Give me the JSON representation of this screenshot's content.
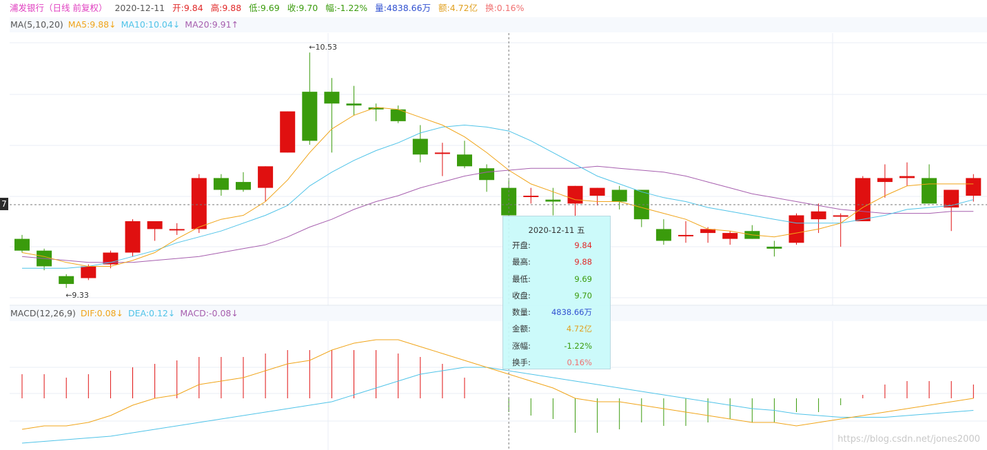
{
  "header": {
    "name": "浦发银行（日线 前复权）",
    "date": "2020-12-11",
    "open": "开:9.84",
    "high": "高:9.88",
    "low": "低:9.69",
    "close": "收:9.70",
    "change": "幅:-1.22%",
    "volume": "量:4838.66万",
    "amount": "额:4.72亿",
    "turnover": "换:0.16%"
  },
  "ma_legend": {
    "label": "MA(5,10,20)",
    "ma5": "MA5:9.88↓",
    "ma10": "MA10:10.04↓",
    "ma20": "MA20:9.91↑"
  },
  "macd_legend": {
    "label": "MACD(12,26,9)",
    "dif": "DIF:0.08↓",
    "dea": "DEA:0.12↓",
    "macd": "MACD:-0.08↓"
  },
  "tooltip": {
    "date": "2020-12-11  五",
    "rows": [
      {
        "label": "开盘:",
        "value": "9.84"
      },
      {
        "label": "最高:",
        "value": "9.88"
      },
      {
        "label": "最低:",
        "value": "9.69"
      },
      {
        "label": "收盘:",
        "value": "9.70"
      },
      {
        "label": "数量:",
        "value": "4838.66万"
      },
      {
        "label": "金额:",
        "value": "4.72亿"
      },
      {
        "label": "涨幅:",
        "value": "-1.22%"
      },
      {
        "label": "换手:",
        "value": "0.16%"
      }
    ]
  },
  "price_marker": "7",
  "watermark": "https://blog.csdn.net/jones2000",
  "colors": {
    "up": "#e01010",
    "down": "#3a9b0c",
    "ma5": "#f0a418",
    "ma10": "#4fc3e8",
    "ma20": "#a65eae",
    "name": "#e040c0",
    "date": "#555555",
    "red": "#e02828",
    "green": "#3a9b0c",
    "blue": "#3050d0",
    "amount": "#e0a020",
    "turnover": "#f07070"
  },
  "chart_data": {
    "type": "candlestick",
    "annotations": {
      "high": "←10.53",
      "low": "←9.33"
    },
    "ylim": [
      9.28,
      10.58
    ],
    "candles": [
      {
        "o": 9.58,
        "h": 9.6,
        "l": 9.51,
        "c": 9.52
      },
      {
        "o": 9.52,
        "h": 9.53,
        "l": 9.42,
        "c": 9.44
      },
      {
        "o": 9.39,
        "h": 9.4,
        "l": 9.33,
        "c": 9.35
      },
      {
        "o": 9.38,
        "h": 9.45,
        "l": 9.37,
        "c": 9.44
      },
      {
        "o": 9.45,
        "h": 9.52,
        "l": 9.43,
        "c": 9.51
      },
      {
        "o": 9.51,
        "h": 9.68,
        "l": 9.49,
        "c": 9.67
      },
      {
        "o": 9.63,
        "h": 9.67,
        "l": 9.57,
        "c": 9.67
      },
      {
        "o": 9.63,
        "h": 9.66,
        "l": 9.6,
        "c": 9.63
      },
      {
        "o": 9.63,
        "h": 9.91,
        "l": 9.61,
        "c": 9.89
      },
      {
        "o": 9.89,
        "h": 9.91,
        "l": 9.8,
        "c": 9.83
      },
      {
        "o": 9.87,
        "h": 9.92,
        "l": 9.82,
        "c": 9.83
      },
      {
        "o": 9.84,
        "h": 9.95,
        "l": 9.77,
        "c": 9.95
      },
      {
        "o": 10.02,
        "h": 10.23,
        "l": 10.02,
        "c": 10.23
      },
      {
        "o": 10.33,
        "h": 10.53,
        "l": 10.06,
        "c": 10.08
      },
      {
        "o": 10.33,
        "h": 10.4,
        "l": 10.02,
        "c": 10.27
      },
      {
        "o": 10.27,
        "h": 10.36,
        "l": 10.21,
        "c": 10.26
      },
      {
        "o": 10.25,
        "h": 10.27,
        "l": 10.18,
        "c": 10.24
      },
      {
        "o": 10.24,
        "h": 10.26,
        "l": 10.17,
        "c": 10.18
      },
      {
        "o": 10.09,
        "h": 10.16,
        "l": 9.97,
        "c": 10.01
      },
      {
        "o": 10.02,
        "h": 10.07,
        "l": 9.9,
        "c": 10.02
      },
      {
        "o": 10.01,
        "h": 10.08,
        "l": 9.94,
        "c": 9.95
      },
      {
        "o": 9.94,
        "h": 9.96,
        "l": 9.82,
        "c": 9.88
      },
      {
        "o": 9.84,
        "h": 9.88,
        "l": 9.69,
        "c": 9.7
      },
      {
        "o": 9.8,
        "h": 9.84,
        "l": 9.76,
        "c": 9.8
      },
      {
        "o": 9.78,
        "h": 9.84,
        "l": 9.7,
        "c": 9.77
      },
      {
        "o": 9.76,
        "h": 9.85,
        "l": 9.69,
        "c": 9.85
      },
      {
        "o": 9.8,
        "h": 9.84,
        "l": 9.75,
        "c": 9.84
      },
      {
        "o": 9.83,
        "h": 9.85,
        "l": 9.73,
        "c": 9.77
      },
      {
        "o": 9.83,
        "h": 9.83,
        "l": 9.64,
        "c": 9.68
      },
      {
        "o": 9.63,
        "h": 9.68,
        "l": 9.55,
        "c": 9.57
      },
      {
        "o": 9.6,
        "h": 9.67,
        "l": 9.56,
        "c": 9.6
      },
      {
        "o": 9.61,
        "h": 9.64,
        "l": 9.56,
        "c": 9.63
      },
      {
        "o": 9.58,
        "h": 9.62,
        "l": 9.55,
        "c": 9.61
      },
      {
        "o": 9.62,
        "h": 9.65,
        "l": 9.58,
        "c": 9.58
      },
      {
        "o": 9.54,
        "h": 9.57,
        "l": 9.49,
        "c": 9.53
      },
      {
        "o": 9.56,
        "h": 9.71,
        "l": 9.55,
        "c": 9.7
      },
      {
        "o": 9.68,
        "h": 9.76,
        "l": 9.61,
        "c": 9.72
      },
      {
        "o": 9.7,
        "h": 9.71,
        "l": 9.54,
        "c": 9.7
      },
      {
        "o": 9.67,
        "h": 9.9,
        "l": 9.67,
        "c": 9.89
      },
      {
        "o": 9.87,
        "h": 9.96,
        "l": 9.79,
        "c": 9.89
      },
      {
        "o": 9.89,
        "h": 9.97,
        "l": 9.85,
        "c": 9.9
      },
      {
        "o": 9.89,
        "h": 9.96,
        "l": 9.77,
        "c": 9.76
      },
      {
        "o": 9.74,
        "h": 9.83,
        "l": 9.62,
        "c": 9.83
      },
      {
        "o": 9.8,
        "h": 9.91,
        "l": 9.77,
        "c": 9.89
      }
    ],
    "ma5": [
      9.51,
      9.49,
      9.46,
      9.44,
      9.44,
      9.47,
      9.51,
      9.58,
      9.64,
      9.68,
      9.7,
      9.77,
      9.88,
      10.02,
      10.14,
      10.21,
      10.25,
      10.24,
      10.2,
      10.16,
      10.1,
      10.02,
      9.93,
      9.86,
      9.82,
      9.78,
      9.77,
      9.77,
      9.74,
      9.71,
      9.68,
      9.63,
      9.62,
      9.6,
      9.59,
      9.61,
      9.63,
      9.66,
      9.74,
      9.8,
      9.85,
      9.86,
      9.86,
      9.86
    ],
    "ma10": [
      9.43,
      9.43,
      9.43,
      9.44,
      9.46,
      9.49,
      9.52,
      9.56,
      9.59,
      9.62,
      9.66,
      9.7,
      9.75,
      9.85,
      9.92,
      9.98,
      10.03,
      10.07,
      10.12,
      10.15,
      10.16,
      10.15,
      10.13,
      10.08,
      10.02,
      9.96,
      9.9,
      9.86,
      9.82,
      9.79,
      9.77,
      9.74,
      9.72,
      9.7,
      9.68,
      9.66,
      9.66,
      9.66,
      9.68,
      9.7,
      9.73,
      9.74,
      9.75,
      9.78
    ],
    "ma20": [
      9.49,
      9.48,
      9.47,
      9.46,
      9.46,
      9.46,
      9.47,
      9.48,
      9.49,
      9.51,
      9.53,
      9.55,
      9.59,
      9.64,
      9.68,
      9.73,
      9.77,
      9.8,
      9.84,
      9.87,
      9.9,
      9.92,
      9.93,
      9.94,
      9.94,
      9.94,
      9.95,
      9.94,
      9.93,
      9.92,
      9.9,
      9.87,
      9.84,
      9.81,
      9.79,
      9.77,
      9.75,
      9.73,
      9.72,
      9.71,
      9.71,
      9.71,
      9.72,
      9.72
    ],
    "macd_ylim": [
      -0.15,
      0.22
    ],
    "dif": [
      -0.09,
      -0.08,
      -0.08,
      -0.07,
      -0.05,
      -0.02,
      0.0,
      0.01,
      0.04,
      0.05,
      0.06,
      0.08,
      0.1,
      0.11,
      0.14,
      0.16,
      0.17,
      0.17,
      0.15,
      0.13,
      0.11,
      0.09,
      0.07,
      0.05,
      0.03,
      0.0,
      -0.01,
      -0.01,
      -0.02,
      -0.03,
      -0.04,
      -0.05,
      -0.06,
      -0.07,
      -0.07,
      -0.08,
      -0.07,
      -0.06,
      -0.05,
      -0.04,
      -0.03,
      -0.02,
      -0.01,
      0.0
    ],
    "dea": [
      -0.13,
      -0.125,
      -0.12,
      -0.115,
      -0.11,
      -0.1,
      -0.09,
      -0.08,
      -0.07,
      -0.06,
      -0.05,
      -0.04,
      -0.03,
      -0.02,
      -0.01,
      0.01,
      0.03,
      0.05,
      0.07,
      0.08,
      0.09,
      0.09,
      0.08,
      0.07,
      0.06,
      0.05,
      0.04,
      0.03,
      0.02,
      0.01,
      0.0,
      -0.01,
      -0.02,
      -0.03,
      -0.035,
      -0.045,
      -0.05,
      -0.055,
      -0.055,
      -0.055,
      -0.05,
      -0.045,
      -0.04,
      -0.035
    ],
    "macd": [
      0.07,
      0.07,
      0.06,
      0.07,
      0.08,
      0.09,
      0.1,
      0.11,
      0.12,
      0.12,
      0.12,
      0.13,
      0.14,
      0.14,
      0.14,
      0.14,
      0.14,
      0.13,
      0.12,
      0.1,
      0.06,
      0.0,
      -0.04,
      -0.05,
      -0.06,
      -0.1,
      -0.1,
      -0.09,
      -0.07,
      -0.08,
      -0.08,
      -0.07,
      -0.06,
      -0.07,
      -0.07,
      -0.04,
      -0.04,
      -0.02,
      0.01,
      0.04,
      0.05,
      0.05,
      0.05,
      0.04
    ]
  }
}
